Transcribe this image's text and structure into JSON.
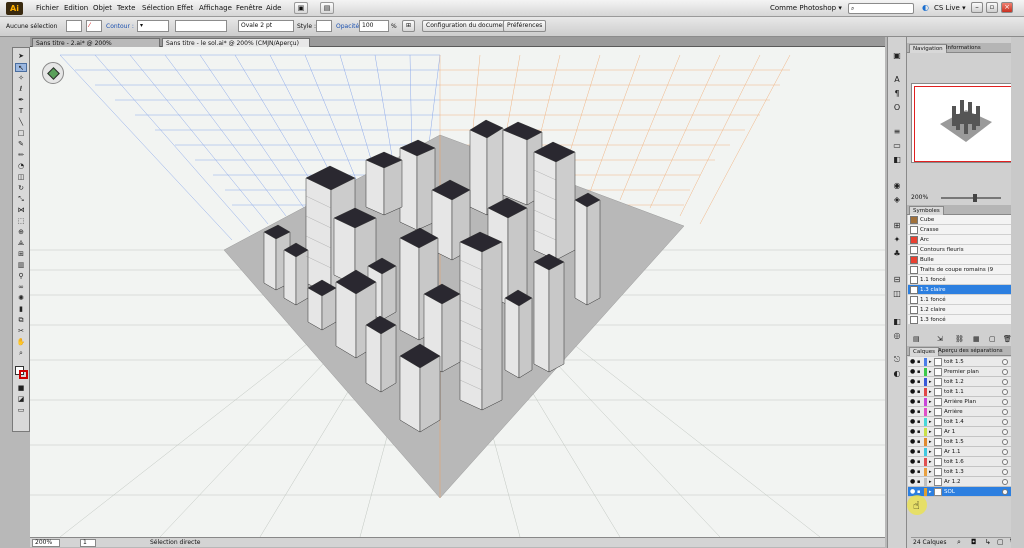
{
  "menubar": {
    "logo": "Ai",
    "menus": [
      "Fichier",
      "Edition",
      "Objet",
      "Texte",
      "Sélection",
      "Effet",
      "Affichage",
      "Fenêtre",
      "Aide"
    ],
    "workspace": "Comme Photoshop ▾",
    "search_placeholder": "",
    "cs_live": "CS Live ▾"
  },
  "control_bar": {
    "selection_label": "Aucune sélection",
    "contour_label": "Contour :",
    "brush_value": "Ovale 2 pt",
    "style_label": "Style :",
    "opacity_label": "Opacité :",
    "opacity_value": "100",
    "opacity_unit": "%",
    "doc_setup_button": "Configuration du document",
    "preferences_button": "Préférences"
  },
  "tabs": [
    {
      "label": "Sans titre - 2.ai* @ 200% (CMJN/Aperçu)",
      "active": false
    },
    {
      "label": "Sans titre - le sol.ai* @ 200% (CMJN/Aperçu)",
      "active": true
    }
  ],
  "status_bar": {
    "zoom": "200%",
    "artboard": "1",
    "tool_status": "Sélection directe"
  },
  "navigation_panel": {
    "tabs": [
      "Navigation",
      "Informations"
    ],
    "zoom": "200%"
  },
  "symbols_panel": {
    "tabs": [
      "Symboles"
    ],
    "items": [
      {
        "label": "Cube",
        "selected": false
      },
      {
        "label": "Crasse",
        "selected": false
      },
      {
        "label": "Arc",
        "selected": false
      },
      {
        "label": "Contours fleuris",
        "selected": false
      },
      {
        "label": "Bulle",
        "selected": false
      },
      {
        "label": "Traits de coupe romains (9 tranches)",
        "selected": false
      },
      {
        "label": "1.1 foncé",
        "selected": false
      },
      {
        "label": "1.3 claire",
        "selected": true
      },
      {
        "label": "1.1 foncé",
        "selected": false
      },
      {
        "label": "1.2 claire",
        "selected": false
      },
      {
        "label": "1.3 foncé",
        "selected": false
      }
    ]
  },
  "layers_panel": {
    "tabs": [
      "Calques",
      "Aperçu des séparations"
    ],
    "count_label": "24 Calques",
    "layers": [
      {
        "label": "toit 1.5",
        "color": "#4a7de8",
        "selected": false
      },
      {
        "label": "Premier plan",
        "color": "#3cc84a",
        "selected": false
      },
      {
        "label": "toit 1.2",
        "color": "#3a5ad8",
        "selected": false
      },
      {
        "label": "toit 1.1",
        "color": "#e04848",
        "selected": false
      },
      {
        "label": "Arrière Plan",
        "color": "#c848d8",
        "selected": false
      },
      {
        "label": "Arrière",
        "color": "#e050c8",
        "selected": false
      },
      {
        "label": "toit 1.4",
        "color": "#48d8d8",
        "selected": false
      },
      {
        "label": "Ar 1",
        "color": "#c8e048",
        "selected": false
      },
      {
        "label": "toit 1.5",
        "color": "#e08a30",
        "selected": false
      },
      {
        "label": "Ar 1.1",
        "color": "#40c8e0",
        "selected": false
      },
      {
        "label": "toit 1.6",
        "color": "#e05050",
        "selected": false
      },
      {
        "label": "toit 1.3",
        "color": "#e8a040",
        "selected": false
      },
      {
        "label": "Ar 1.2",
        "color": "#c0c0c0",
        "selected": false
      },
      {
        "label": "SOL",
        "color": "#e0a030",
        "selected": true
      }
    ]
  },
  "colors": {
    "selection_blue": "#2c7fe0",
    "grid_left": "#5a86e6",
    "grid_right": "#ef9a50",
    "ground": "#b8b8b8"
  }
}
